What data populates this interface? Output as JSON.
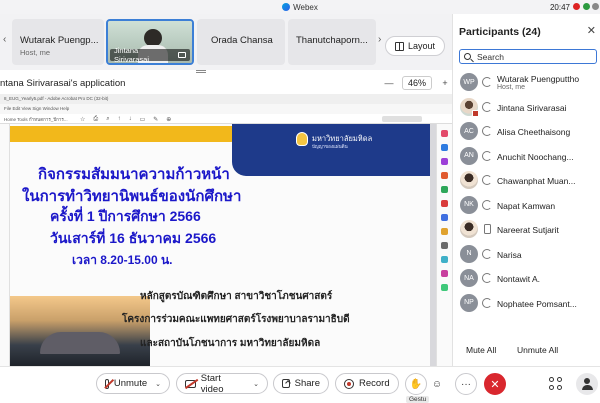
{
  "window": {
    "app_name": "Webex",
    "clock": "20:47"
  },
  "strip": {
    "tiles": [
      {
        "name": "Wutarak Puengp...",
        "sub": "Host, me"
      },
      {
        "name": "Jintana Sirivarasai"
      },
      {
        "name": "Orada Chansa"
      },
      {
        "name": "Thanutchaporn..."
      }
    ],
    "layout_label": "Layout"
  },
  "share": {
    "title": "ntana Sirivarasai's application",
    "zoom_out": "—",
    "zoom_value": "46%",
    "zoom_in": "+"
  },
  "pdf": {
    "chrome_line1": "8_EUG_Yearly5.pdf - Adobe Acrobat Pro DC (32-bit)",
    "chrome_line2": "File   Edit   View   Sign   Window   Help",
    "chrome_line3": "Home   Tools   กำหนดการ_ปีการ..."
  },
  "slide": {
    "university_th": "มหาวิทยาลัยมหิดล",
    "university_sub": "ปัญญาของแผ่นดิน",
    "line1": "กิจกรรมสัมมนาความก้าวหน้า",
    "line2": "ในการทำวิทยานิพนธ์ของนักศึกษา",
    "line3": "ครั้งที่ 1 ปีการศึกษา 2566",
    "line4": "วันเสาร์ที่ 16 ธันวาคม 2566",
    "line5": "เวลา 8.20-15.00 น.",
    "body1": "หลักสูตรบัณฑิตศึกษา สาขาวิชาโภชนศาสตร์",
    "body2": "โครงการร่วมคณะแพทยศาสตร์โรงพยาบาลรามาธิบดี",
    "body3": "และสถาบันโภชนาการ มหาวิทยาลัยมหิดล"
  },
  "participants": {
    "title": "Participants (24)",
    "search_placeholder": "Search",
    "list": [
      {
        "initials": "WP",
        "name": "Wutarak Puengputtho",
        "role": "Host, me",
        "color": "#8a8f98",
        "device": "sync"
      },
      {
        "initials": "",
        "name": "Jintana Sirivarasai",
        "color": "photo1",
        "device": "sync",
        "badge": true
      },
      {
        "initials": "AC",
        "name": "Alisa Cheethaisong",
        "color": "#8a8f98",
        "device": "sync"
      },
      {
        "initials": "AN",
        "name": "Anuchit Noochang...",
        "color": "#8a8f98",
        "device": "sync"
      },
      {
        "initials": "",
        "name": "Chawanphat Muan...",
        "color": "photo2",
        "device": "sync"
      },
      {
        "initials": "NK",
        "name": "Napat Kamwan",
        "color": "#8a8f98",
        "device": "sync"
      },
      {
        "initials": "",
        "name": "Nareerat Sutjarit",
        "color": "photo2",
        "device": "phone"
      },
      {
        "initials": "N",
        "name": "Narisa",
        "color": "#8a8f98",
        "device": "sync"
      },
      {
        "initials": "NA",
        "name": "Nontawit A.",
        "color": "#8a8f98",
        "device": "sync"
      },
      {
        "initials": "NP",
        "name": "Nophatee Pomsant...",
        "color": "#8a8f98",
        "device": "sync"
      }
    ],
    "mute_all": "Mute All",
    "unmute_all": "Unmute All"
  },
  "controls": {
    "unmute": "Unmute",
    "start_video": "Start video",
    "share": "Share",
    "record": "Record",
    "gesture_label": "Gestu",
    "more": "···",
    "end": "✕",
    "chevron": "⌄"
  },
  "colors": {
    "accent": "#3d78d6",
    "end_call": "#d9272e",
    "slide_title": "#1b17c9",
    "slide_navy": "#1e3a8a",
    "slide_yellow": "#f2b81b"
  }
}
